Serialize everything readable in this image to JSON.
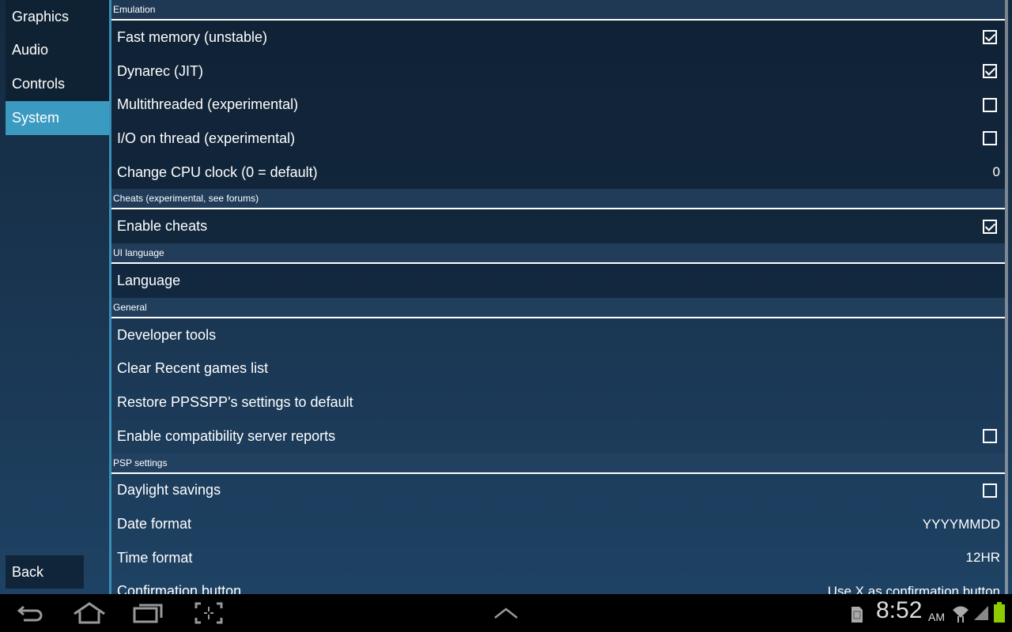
{
  "sidebar": {
    "items": [
      {
        "label": "Graphics"
      },
      {
        "label": "Audio"
      },
      {
        "label": "Controls"
      },
      {
        "label": "System",
        "active": true
      }
    ],
    "back_label": "Back"
  },
  "sections": [
    {
      "title": "Emulation",
      "rows": [
        {
          "label": "Fast memory (unstable)",
          "checked": true
        },
        {
          "label": "Dynarec (JIT)",
          "checked": true
        },
        {
          "label": "Multithreaded (experimental)",
          "checked": false
        },
        {
          "label": "I/O on thread (experimental)",
          "checked": false
        },
        {
          "label": "Change CPU clock (0 = default)",
          "value": "0"
        }
      ]
    },
    {
      "title": "Cheats (experimental, see forums)",
      "rows": [
        {
          "label": "Enable cheats",
          "checked": true
        }
      ]
    },
    {
      "title": "UI language",
      "rows": [
        {
          "label": "Language"
        }
      ]
    },
    {
      "title": "General",
      "rows": [
        {
          "label": "Developer tools"
        },
        {
          "label": "Clear Recent games list"
        },
        {
          "label": "Restore PPSSPP's settings to default"
        },
        {
          "label": "Enable compatibility server reports",
          "checked": false
        }
      ]
    },
    {
      "title": "PSP settings",
      "rows": [
        {
          "label": "Daylight savings",
          "checked": false
        },
        {
          "label": "Date format",
          "value": "YYYYMMDD"
        },
        {
          "label": "Time format",
          "value": "12HR"
        },
        {
          "label": "Confirmation button",
          "value": "Use X as confirmation button"
        }
      ]
    }
  ],
  "statusbar": {
    "time": "8:52",
    "ampm": "AM",
    "icons": [
      "sd-card-icon",
      "wifi-icon",
      "signal-icon",
      "battery-icon"
    ]
  },
  "navbar": {
    "icons": [
      "back-icon",
      "home-icon",
      "recent-apps-icon",
      "screenshot-icon",
      "up-chevron-icon"
    ]
  },
  "colors": {
    "accent": "#3a9ac0",
    "battery": "#8ccc00"
  }
}
